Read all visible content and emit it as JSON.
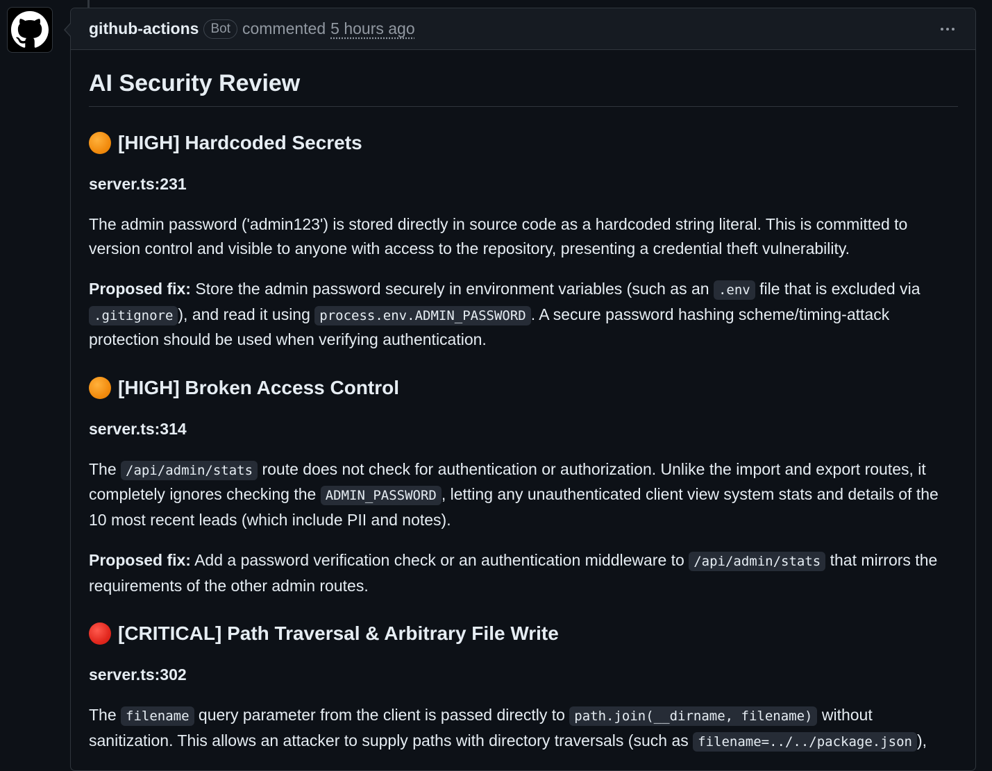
{
  "comment": {
    "author": "github-actions",
    "badge": "Bot",
    "action": "commented",
    "timestamp": "5 hours ago"
  },
  "review": {
    "title": "AI Security Review",
    "findings": [
      {
        "severity_color": "#f28c0f",
        "heading": "[HIGH] Hardcoded Secrets",
        "file": "server.ts:231",
        "description": "The admin password ('admin123') is stored directly in source code as a hardcoded string literal. This is committed to version control and visible to anyone with access to the repository, presenting a credential theft vulnerability.",
        "fix_label": "Proposed fix:",
        "fix_parts": [
          " Store the admin password securely in environment variables (such as an ",
          ".env",
          " file that is excluded via ",
          ".gitignore",
          "), and read it using ",
          "process.env.ADMIN_PASSWORD",
          ". A secure password hashing scheme/timing-attack protection should be used when verifying authentication."
        ]
      },
      {
        "severity_color": "#f28c0f",
        "heading": "[HIGH] Broken Access Control",
        "file": "server.ts:314",
        "desc_parts": [
          "The ",
          "/api/admin/stats",
          " route does not check for authentication or authorization. Unlike the import and export routes, it completely ignores checking the ",
          "ADMIN_PASSWORD",
          ", letting any unauthenticated client view system stats and details of the 10 most recent leads (which include PII and notes)."
        ],
        "fix_label": "Proposed fix:",
        "fix_parts": [
          " Add a password verification check or an authentication middleware to ",
          "/api/admin/stats",
          " that mirrors the requirements of the other admin routes."
        ]
      },
      {
        "severity_color": "#e2281e",
        "heading": "[CRITICAL] Path Traversal & Arbitrary File Write",
        "file": "server.ts:302",
        "desc_parts": [
          "The ",
          "filename",
          " query parameter from the client is passed directly to ",
          "path.join(__dirname, filename)",
          " without sanitization. This allows an attacker to supply paths with directory traversals (such as ",
          "filename=../../package.json",
          "),"
        ]
      }
    ]
  }
}
